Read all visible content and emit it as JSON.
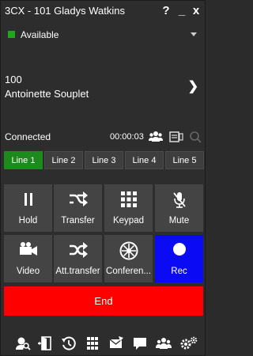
{
  "window": {
    "title": "3CX - 101 Gladys Watkins",
    "help_label": "?",
    "minimize_label": "_",
    "close_label": "x"
  },
  "status": {
    "label": "Available",
    "color": "#1fa81f"
  },
  "contact": {
    "number": "100",
    "name": "Antoinette Souplet"
  },
  "call": {
    "state": "Connected",
    "timer": "00:00:03"
  },
  "lines": [
    {
      "label": "Line 1",
      "active": true
    },
    {
      "label": "Line 2",
      "active": false
    },
    {
      "label": "Line 3",
      "active": false
    },
    {
      "label": "Line 4",
      "active": false
    },
    {
      "label": "Line 5",
      "active": false
    }
  ],
  "actions": {
    "hold": "Hold",
    "transfer": "Transfer",
    "keypad": "Keypad",
    "mute": "Mute",
    "video": "Video",
    "att_transfer": "Att.transfer",
    "conference": "Conferen...",
    "rec": "Rec"
  },
  "end_label": "End",
  "colors": {
    "active_line": "#1d8a1d",
    "rec": "#0a0af5",
    "end": "#ff0000",
    "button": "#444444"
  },
  "bottom_icons": [
    "contacts-search-icon",
    "exit-icon",
    "history-icon",
    "dialpad-icon",
    "voicemail-icon",
    "chat-icon",
    "presence-icon",
    "settings-icon"
  ]
}
